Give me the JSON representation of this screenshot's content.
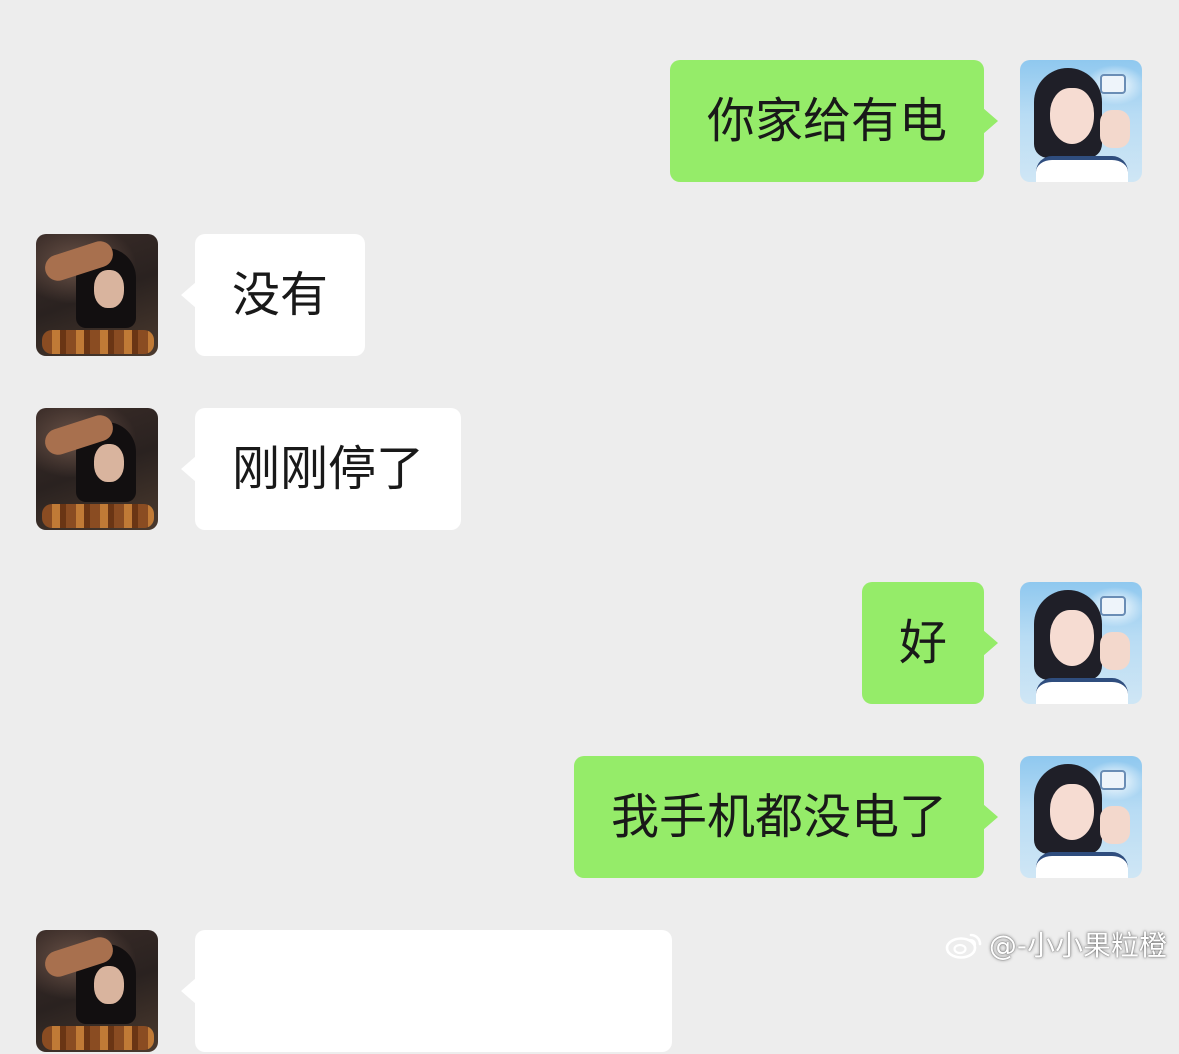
{
  "colors": {
    "background": "#ededed",
    "sent_bubble": "#95ec69",
    "received_bubble": "#ffffff",
    "text": "#191919"
  },
  "messages": [
    {
      "side": "right",
      "sender": "me",
      "text": "你家给有电",
      "avatar_icon": "user-avatar-icon"
    },
    {
      "side": "left",
      "sender": "contact",
      "text": "没有",
      "avatar_icon": "contact-avatar-icon"
    },
    {
      "side": "left",
      "sender": "contact",
      "text": "刚刚停了",
      "avatar_icon": "contact-avatar-icon"
    },
    {
      "side": "right",
      "sender": "me",
      "text": "好",
      "avatar_icon": "user-avatar-icon"
    },
    {
      "side": "right",
      "sender": "me",
      "text": "我手机都没电了",
      "avatar_icon": "user-avatar-icon"
    },
    {
      "side": "left",
      "sender": "contact",
      "text": "",
      "avatar_icon": "contact-avatar-icon"
    }
  ],
  "watermark": {
    "icon": "weibo-icon",
    "text": "@-小小果粒橙"
  }
}
